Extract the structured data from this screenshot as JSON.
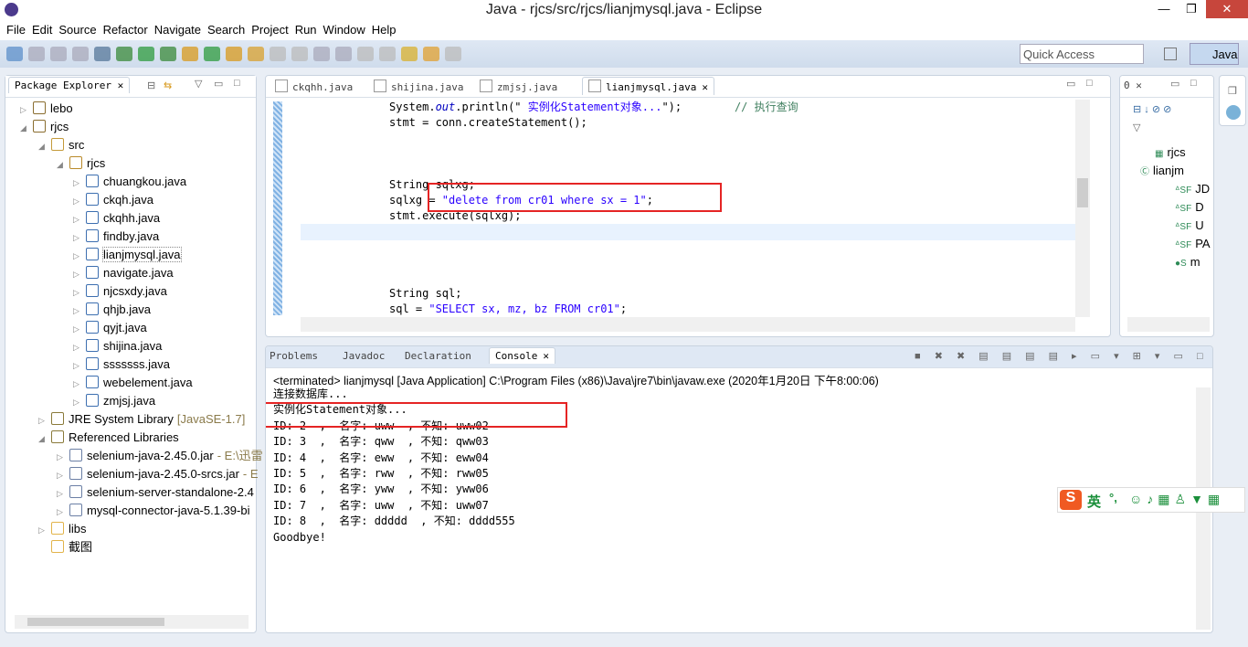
{
  "window": {
    "title": "Java - rjcs/src/rjcs/lianjmysql.java - Eclipse",
    "minimize": "—",
    "restore": "❐",
    "close": "✕"
  },
  "menu": [
    "File",
    "Edit",
    "Source",
    "Refactor",
    "Navigate",
    "Search",
    "Project",
    "Run",
    "Window",
    "Help"
  ],
  "quick_access": {
    "placeholder": "Quick Access"
  },
  "perspective": {
    "label": "Java"
  },
  "package_explorer": {
    "title": "Package Explorer",
    "tree": [
      {
        "label": "lebo",
        "level": 0,
        "exp": "▷",
        "icon": "project"
      },
      {
        "label": "rjcs",
        "level": 0,
        "exp": "◢",
        "icon": "project"
      },
      {
        "label": "src",
        "level": 1,
        "exp": "◢",
        "icon": "src"
      },
      {
        "label": "rjcs",
        "level": 2,
        "exp": "◢",
        "icon": "package"
      },
      {
        "label": "chuangkou.java",
        "level": 3,
        "exp": "▷",
        "icon": "java"
      },
      {
        "label": "ckqh.java",
        "level": 3,
        "exp": "▷",
        "icon": "java"
      },
      {
        "label": "ckqhh.java",
        "level": 3,
        "exp": "▷",
        "icon": "java"
      },
      {
        "label": "findby.java",
        "level": 3,
        "exp": "▷",
        "icon": "java"
      },
      {
        "label": "lianjmysql.java",
        "level": 3,
        "exp": "▷",
        "icon": "java",
        "selected": true
      },
      {
        "label": "navigate.java",
        "level": 3,
        "exp": "▷",
        "icon": "java"
      },
      {
        "label": "njcsxdy.java",
        "level": 3,
        "exp": "▷",
        "icon": "java"
      },
      {
        "label": "qhjb.java",
        "level": 3,
        "exp": "▷",
        "icon": "java"
      },
      {
        "label": "qyjt.java",
        "level": 3,
        "exp": "▷",
        "icon": "java"
      },
      {
        "label": "shijina.java",
        "level": 3,
        "exp": "▷",
        "icon": "java"
      },
      {
        "label": "sssssss.java",
        "level": 3,
        "exp": "▷",
        "icon": "java"
      },
      {
        "label": "webelement.java",
        "level": 3,
        "exp": "▷",
        "icon": "java"
      },
      {
        "label": "zmjsj.java",
        "level": 3,
        "exp": "▷",
        "icon": "java"
      },
      {
        "label": "JRE System Library",
        "suffix": "[JavaSE-1.7]",
        "level": 1,
        "exp": "▷",
        "icon": "lib"
      },
      {
        "label": "Referenced Libraries",
        "level": 1,
        "exp": "◢",
        "icon": "lib"
      },
      {
        "label": "selenium-java-2.45.0.jar",
        "suffix": "- E:\\迅雷",
        "level": 2,
        "exp": "▷",
        "icon": "jar"
      },
      {
        "label": "selenium-java-2.45.0-srcs.jar",
        "suffix": "- E",
        "level": 2,
        "exp": "▷",
        "icon": "jar"
      },
      {
        "label": "selenium-server-standalone-2.4",
        "level": 2,
        "exp": "▷",
        "icon": "jar"
      },
      {
        "label": "mysql-connector-java-5.1.39-bi",
        "level": 2,
        "exp": "▷",
        "icon": "jar"
      },
      {
        "label": "libs",
        "level": 1,
        "exp": "▷",
        "icon": "folder"
      },
      {
        "label": "截图",
        "level": 1,
        "exp": "",
        "icon": "folder"
      }
    ]
  },
  "editor": {
    "tabs": [
      "ckqhh.java",
      "shijina.java",
      "zmjsj.java",
      "lianjmysql.java"
    ],
    "active_tab": 3,
    "lines": [
      [
        {
          "t": "System.",
          "c": "#000"
        },
        {
          "t": "out",
          "c": "#0000c0",
          "i": true
        },
        {
          "t": ".println(\" ",
          "c": "#000"
        },
        {
          "t": "实例化Statement对象...",
          "c": "#2a00ff"
        },
        {
          "t": "\");",
          "c": "#000"
        },
        {
          "t": "        // 执行查询",
          "c": "#3f7f5f"
        }
      ],
      [
        {
          "t": "stmt = conn.createStatement();",
          "c": "#000"
        }
      ],
      [],
      [],
      [],
      [
        {
          "t": "String sqlxg;",
          "c": "#000"
        }
      ],
      [
        {
          "t": "sqlxg = ",
          "c": "#000"
        },
        {
          "t": "\"delete from cr01 where sx = 1\"",
          "c": "#2a00ff"
        },
        {
          "t": ";",
          "c": "#000"
        }
      ],
      [
        {
          "t": "stmt.execute(sqlxg);",
          "c": "#000"
        }
      ],
      [],
      [],
      [],
      [],
      [
        {
          "t": "String sql;",
          "c": "#000"
        }
      ],
      [
        {
          "t": "sql = ",
          "c": "#000"
        },
        {
          "t": "\"SELECT sx, mz, bz FROM cr01\"",
          "c": "#2a00ff"
        },
        {
          "t": ";",
          "c": "#000"
        }
      ]
    ]
  },
  "outline": {
    "tab": "0",
    "items": [
      {
        "label": "rjcs",
        "mark": "▦"
      },
      {
        "label": "lianjm",
        "mark": "Ⓒ"
      },
      {
        "label": "JD",
        "mark": "ᐞSF"
      },
      {
        "label": "D",
        "mark": "ᐞSF"
      },
      {
        "label": "U",
        "mark": "ᐞSF"
      },
      {
        "label": "PA",
        "mark": "ᐞSF"
      },
      {
        "label": "m",
        "mark": "●S"
      }
    ]
  },
  "console_view": {
    "tabs": [
      "Problems",
      "Javadoc",
      "Declaration",
      "Console"
    ],
    "active_tab": 3,
    "header": "<terminated> lianjmysql [Java Application] C:\\Program Files (x86)\\Java\\jre7\\bin\\javaw.exe (2020年1月20日 下午8:00:06)",
    "lines": [
      "连接数据库...",
      "实例化Statement对象...",
      "ID: 2  ,  名字: uww  , 不知: uww02",
      "ID: 3  ,  名字: qww  , 不知: qww03",
      "ID: 4  ,  名字: eww  , 不知: eww04",
      "ID: 5  ,  名字: rww  , 不知: rww05",
      "ID: 6  ,  名字: yww  , 不知: yww06",
      "ID: 7  ,  名字: uww  , 不知: uww07",
      "ID: 8  ,  名字: ddddd  , 不知: dddd555",
      "Goodbye!"
    ]
  },
  "ime": {
    "logo": "S",
    "lang": "英",
    "punct": "°,"
  }
}
